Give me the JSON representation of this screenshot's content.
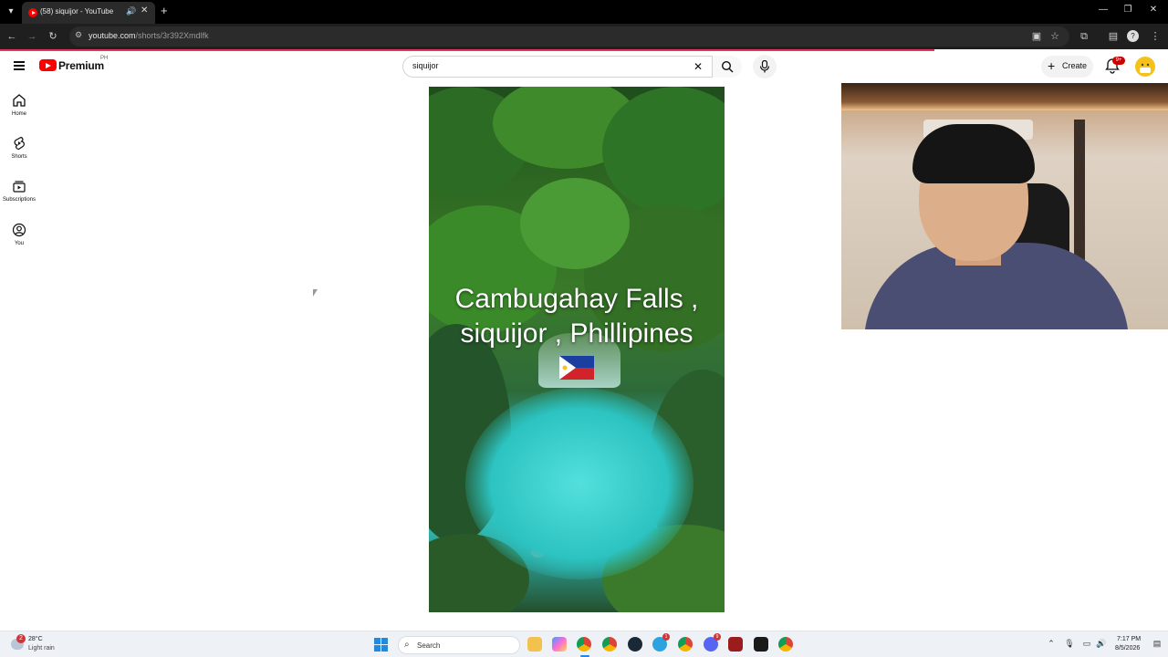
{
  "browser": {
    "tab_title": "(58) siquijor - YouTube",
    "url_domain": "youtube.com",
    "url_path": "/shorts/3r392Xmdlfk"
  },
  "youtube": {
    "brand": "Premium",
    "country": "PH",
    "search_value": "siquijor",
    "create_label": "Create",
    "notifications_badge": "9+",
    "guide": [
      {
        "label": "Home",
        "icon": "home-icon"
      },
      {
        "label": "Shorts",
        "icon": "shorts-icon"
      },
      {
        "label": "Subscriptions",
        "icon": "subscriptions-icon"
      },
      {
        "label": "You",
        "icon": "account-icon"
      }
    ],
    "short": {
      "caption_line1": "Cambugahay Falls ,",
      "caption_line2": "siquijor , Phillipines"
    }
  },
  "taskbar": {
    "weather_temp": "28°C",
    "weather_desc": "Light rain",
    "weather_badge": "2",
    "search_label": "Search",
    "time": "7:17 PM",
    "date": "8/5/2026",
    "app_badges": {
      "telegram": "1",
      "discord": "9"
    }
  },
  "colors": {
    "youtube_red": "#ff0000",
    "progress": "#e2365d",
    "taskbar": "#eef1f6"
  }
}
